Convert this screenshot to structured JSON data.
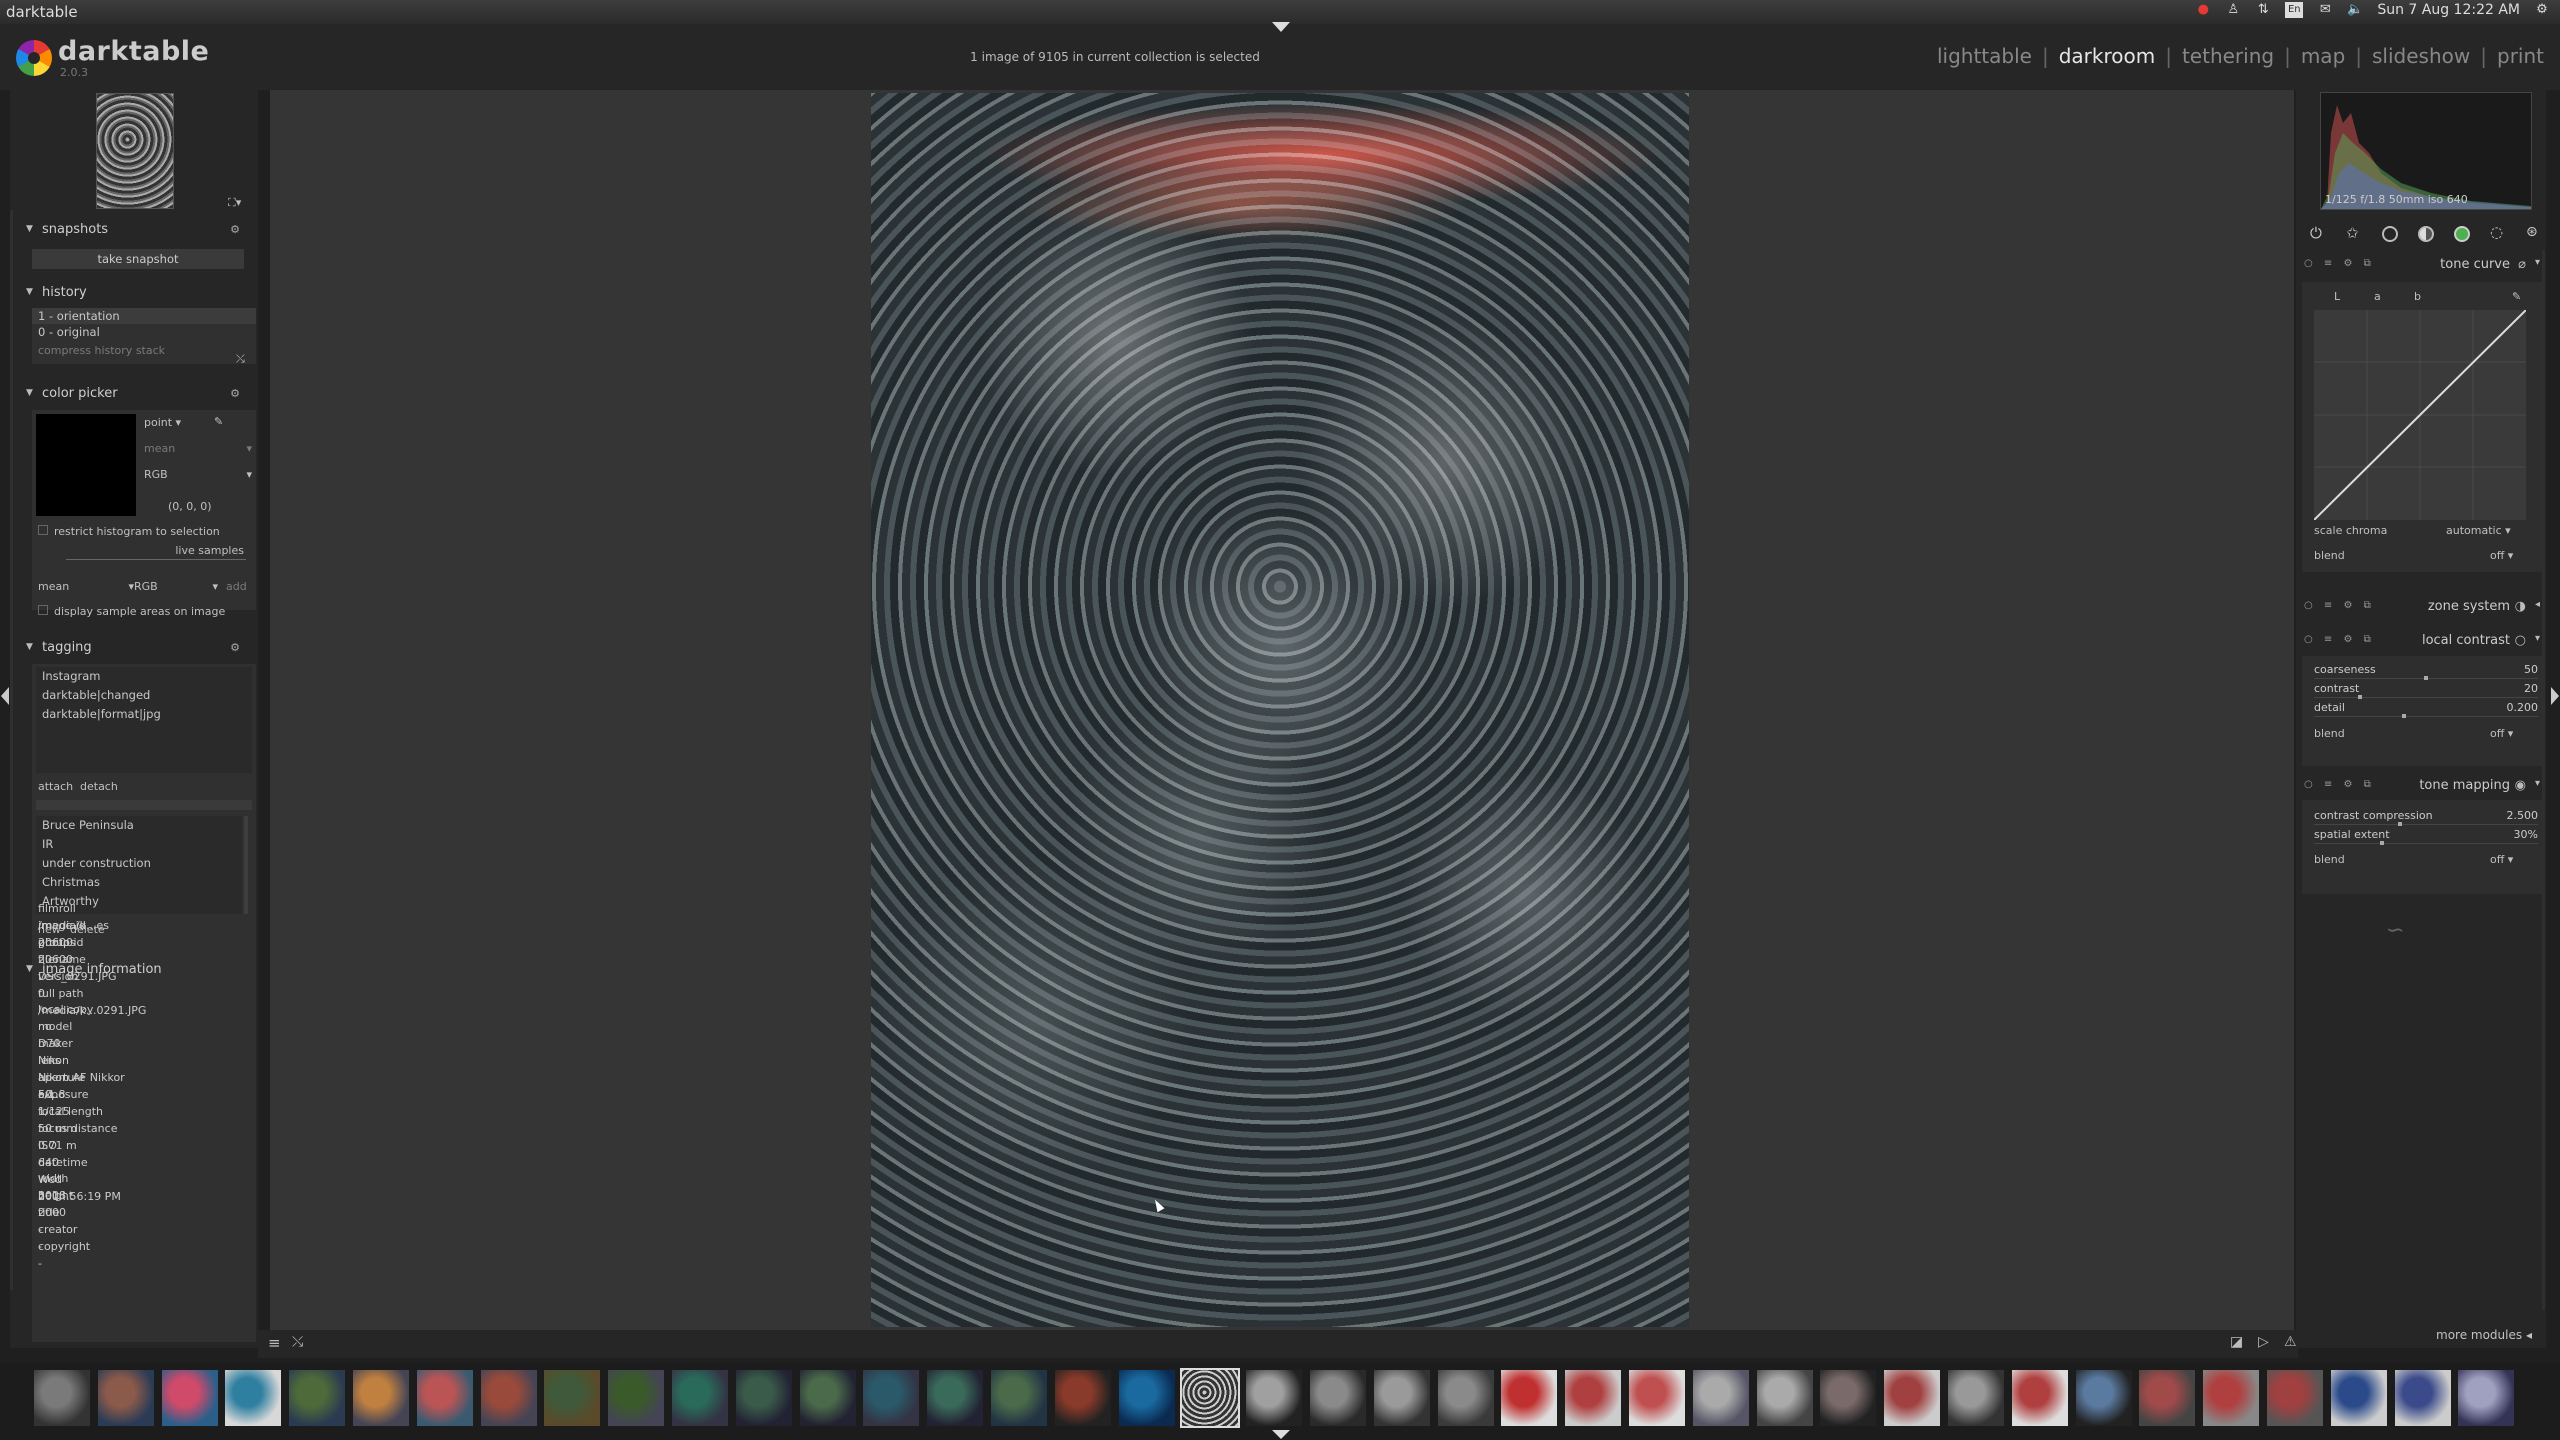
{
  "os": {
    "app_name": "darktable",
    "lang": "En",
    "datetime": "Sun 7 Aug 12:22 AM"
  },
  "header": {
    "brand": "darktable",
    "version": "2.0.3",
    "collection_info": "1 image of 9105 in current collection is selected",
    "views": [
      "lighttable",
      "darkroom",
      "tethering",
      "map",
      "slideshow",
      "print"
    ],
    "active_view": "darkroom"
  },
  "left": {
    "snapshots": {
      "title": "snapshots",
      "take_label": "take snapshot"
    },
    "history": {
      "title": "history",
      "items": [
        "1 - orientation",
        "0 - original"
      ],
      "compress_label": "compress history stack"
    },
    "color_picker": {
      "title": "color picker",
      "mode": "point",
      "stat": "mean",
      "model": "RGB",
      "value": "(0, 0, 0)",
      "restrict_label": "restrict histogram to selection",
      "live_samples_label": "live samples",
      "sample_stat": "mean",
      "sample_model": "RGB",
      "add_label": "add",
      "display_label": "display sample areas on image"
    },
    "tagging": {
      "title": "tagging",
      "attached": [
        "Instagram",
        "darktable|changed",
        "darktable|format|jpg"
      ],
      "attach_label": "attach",
      "detach_label": "detach",
      "dictionary": [
        "Bruce Peninsula",
        "IR",
        "under construction",
        "Christmas",
        "Artworthy"
      ],
      "new_label": "new",
      "delete_label": "delete"
    },
    "image_information": {
      "title": "image information",
      "rows": [
        {
          "k": "filmroll",
          "v": "/media/k...es photos"
        },
        {
          "k": "image id",
          "v": "20600"
        },
        {
          "k": "group id",
          "v": "20600"
        },
        {
          "k": "filename",
          "v": "DSC_0291.JPG"
        },
        {
          "k": "version",
          "v": "0"
        },
        {
          "k": "full path",
          "v": "/media/k...0291.JPG"
        },
        {
          "k": "local copy",
          "v": "no"
        },
        {
          "k": "model",
          "v": "D70"
        },
        {
          "k": "maker",
          "v": "Nikon"
        },
        {
          "k": "lens",
          "v": "Nikon AF Nikkor 50..."
        },
        {
          "k": "aperture",
          "v": "F/1.8"
        },
        {
          "k": "exposure",
          "v": "1/125"
        },
        {
          "k": "focal length",
          "v": "50 mm"
        },
        {
          "k": "focus distance",
          "v": "0.71 m"
        },
        {
          "k": "ISO",
          "v": "640"
        },
        {
          "k": "datetime",
          "v": "Wed 201...56:19 PM"
        },
        {
          "k": "width",
          "v": "3008"
        },
        {
          "k": "height",
          "v": "2000"
        },
        {
          "k": "title",
          "v": "-"
        },
        {
          "k": "creator",
          "v": "-"
        },
        {
          "k": "copyright",
          "v": "-"
        }
      ]
    }
  },
  "right": {
    "histogram_info": "1/125 f/1.8 50mm iso 640",
    "tone_curve": {
      "title": "tone curve",
      "channels": [
        "L",
        "a",
        "b"
      ],
      "scale_chroma_label": "scale chroma",
      "scale_chroma_value": "automatic",
      "blend_label": "blend",
      "blend_value": "off"
    },
    "zone_system": {
      "title": "zone system"
    },
    "local_contrast": {
      "title": "local contrast",
      "sliders": [
        {
          "label": "coarseness",
          "value": "50",
          "fraction": 0.5
        },
        {
          "label": "contrast",
          "value": "20",
          "fraction": 0.2
        },
        {
          "label": "detail",
          "value": "0.200",
          "fraction": 0.4
        }
      ],
      "blend_label": "blend",
      "blend_value": "off"
    },
    "tone_mapping": {
      "title": "tone mapping",
      "sliders": [
        {
          "label": "contrast compression",
          "value": "2.500",
          "fraction": 0.38
        },
        {
          "label": "spatial extent",
          "value": "30%",
          "fraction": 0.3
        }
      ],
      "blend_label": "blend",
      "blend_value": "off"
    },
    "more_modules_label": "more modules"
  }
}
